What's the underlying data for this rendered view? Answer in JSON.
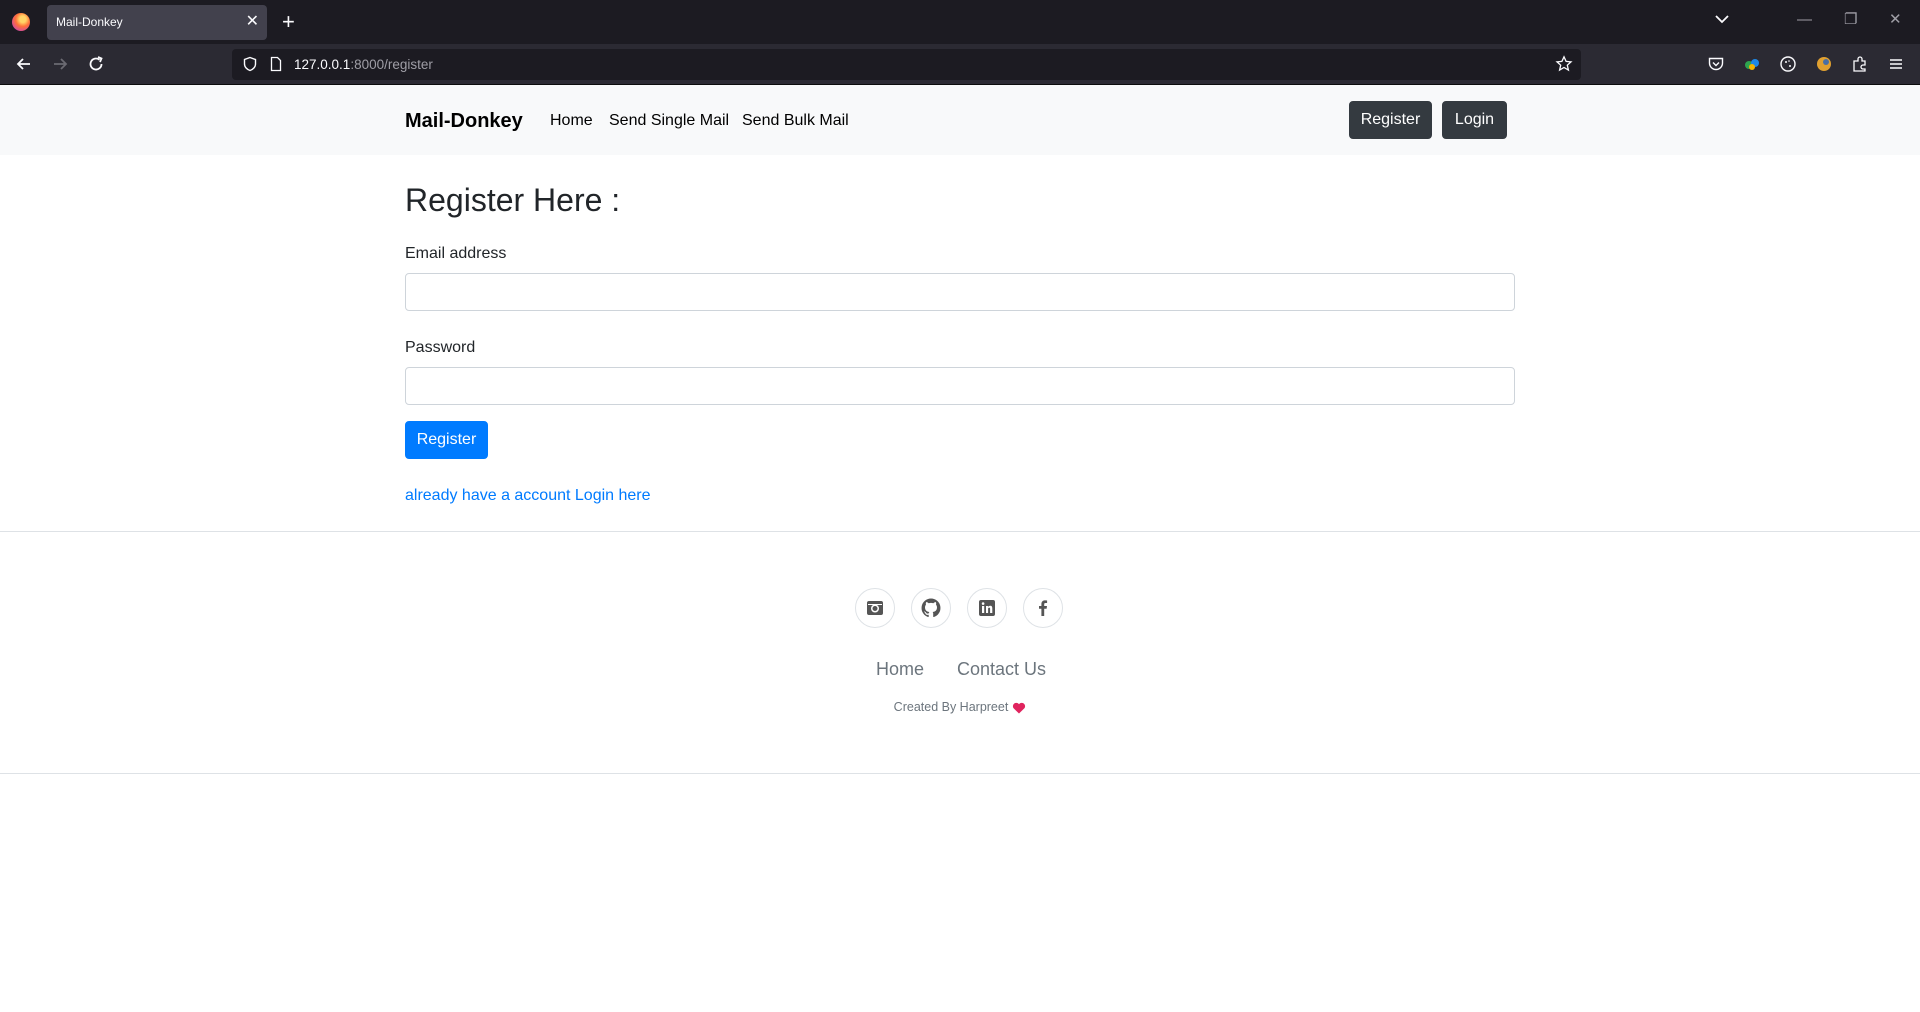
{
  "browser": {
    "tab_title": "Mail-Donkey",
    "tab_close": "✕",
    "new_tab": "+",
    "url_host": "127.0.0.1",
    "url_path": ":8000/register",
    "window_controls": {
      "minimize": "—",
      "restore": "❐",
      "close": "✕"
    }
  },
  "site": {
    "brand": "Mail-Donkey",
    "nav_links": [
      "Home",
      "Send Single Mail",
      "Send Bulk Mail"
    ],
    "register_button": "Register",
    "login_button": "Login"
  },
  "form": {
    "title": "Register Here :",
    "email_label": "Email address",
    "email_value": "",
    "password_label": "Password",
    "password_value": "",
    "submit_label": "Register",
    "login_link": "already have a account Login here"
  },
  "footer": {
    "social_icons": [
      "instagram-icon",
      "github-icon",
      "linkedin-icon",
      "facebook-icon"
    ],
    "links": [
      "Home",
      "Contact Us"
    ],
    "credit": "Created By Harpreet"
  },
  "colors": {
    "primary": "#007bff",
    "dark_button": "#343a40",
    "navbar_bg": "#f8f9fa",
    "heart": "#e0245e"
  }
}
